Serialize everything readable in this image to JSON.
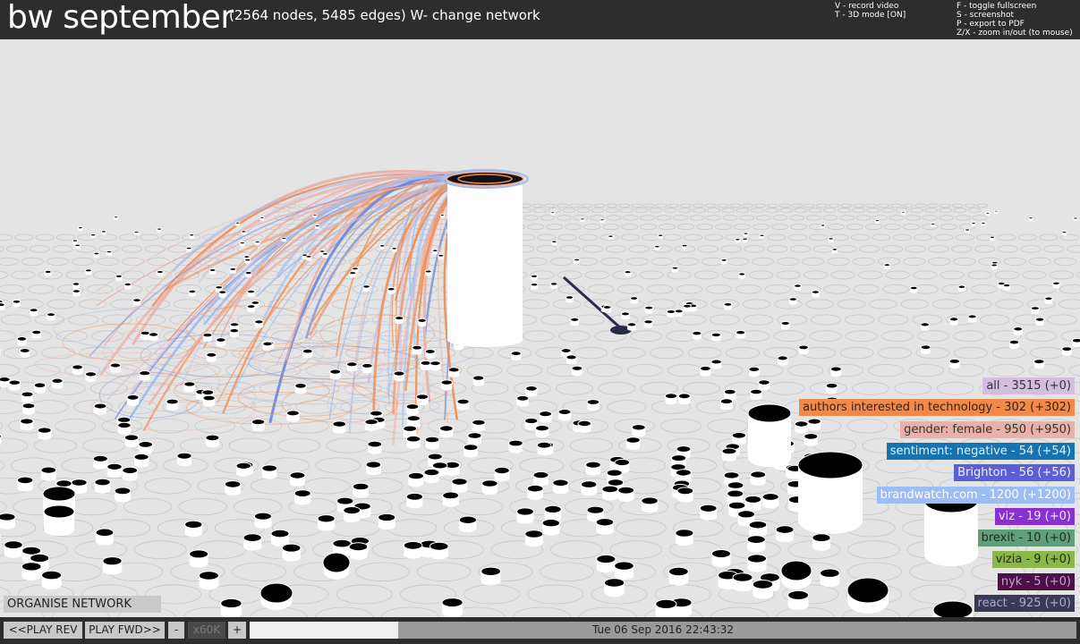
{
  "header": {
    "title": "bw september",
    "subtitle": "(2564 nodes, 5485 edges)  W- change network",
    "hints_left": [
      "V - record video",
      "T - 3D mode [ON]"
    ],
    "hints_right": [
      "F - toggle fullscreen",
      "S - screenshot",
      "P - export to PDF",
      "Z/X - zoom in/out (to mouse)"
    ]
  },
  "legend": [
    {
      "label": "all - 3515 (+0)",
      "bg": "#d4bedf",
      "fg": "#333333"
    },
    {
      "label": "authors interested in technology - 302 (+302)",
      "bg": "#f08a4b",
      "fg": "#3a2010"
    },
    {
      "label": "gender: female - 950 (+950)",
      "bg": "#e9b1a9",
      "fg": "#333333"
    },
    {
      "label": "sentiment: negative - 54 (+54)",
      "bg": "#1474b0",
      "fg": "#e6eef5"
    },
    {
      "label": "Brighton - 56 (+56)",
      "bg": "#5b5fd6",
      "fg": "#f0f0ff"
    },
    {
      "label": "brandwatch.com - 1200 (+1200)",
      "bg": "#9bbdf1",
      "fg": "#ffffff"
    },
    {
      "label": "viz - 19 (+0)",
      "bg": "#8a2fd0",
      "fg": "#f3e6ff"
    },
    {
      "label": "brexit - 10 (+0)",
      "bg": "#5fa07a",
      "fg": "#1a2a20"
    },
    {
      "label": "vizia - 9 (+0)",
      "bg": "#8cb84a",
      "fg": "#1e2a10"
    },
    {
      "label": "nyk - 5 (+0)",
      "bg": "#4c1248",
      "fg": "#c9a0c6"
    },
    {
      "label": "react - 925 (+0)",
      "bg": "#3a3a58",
      "fg": "#aaaacc"
    }
  ],
  "controls": {
    "organise": "ORGANISE NETWORK",
    "play_rev": "<<PLAY REV",
    "play_fwd": "PLAY FWD>>",
    "minus": "-",
    "speed": "x60K",
    "plus": "+",
    "timestamp": "Tue 06 Sep 2016 22:43:32",
    "timeline_progress": 0.18
  }
}
